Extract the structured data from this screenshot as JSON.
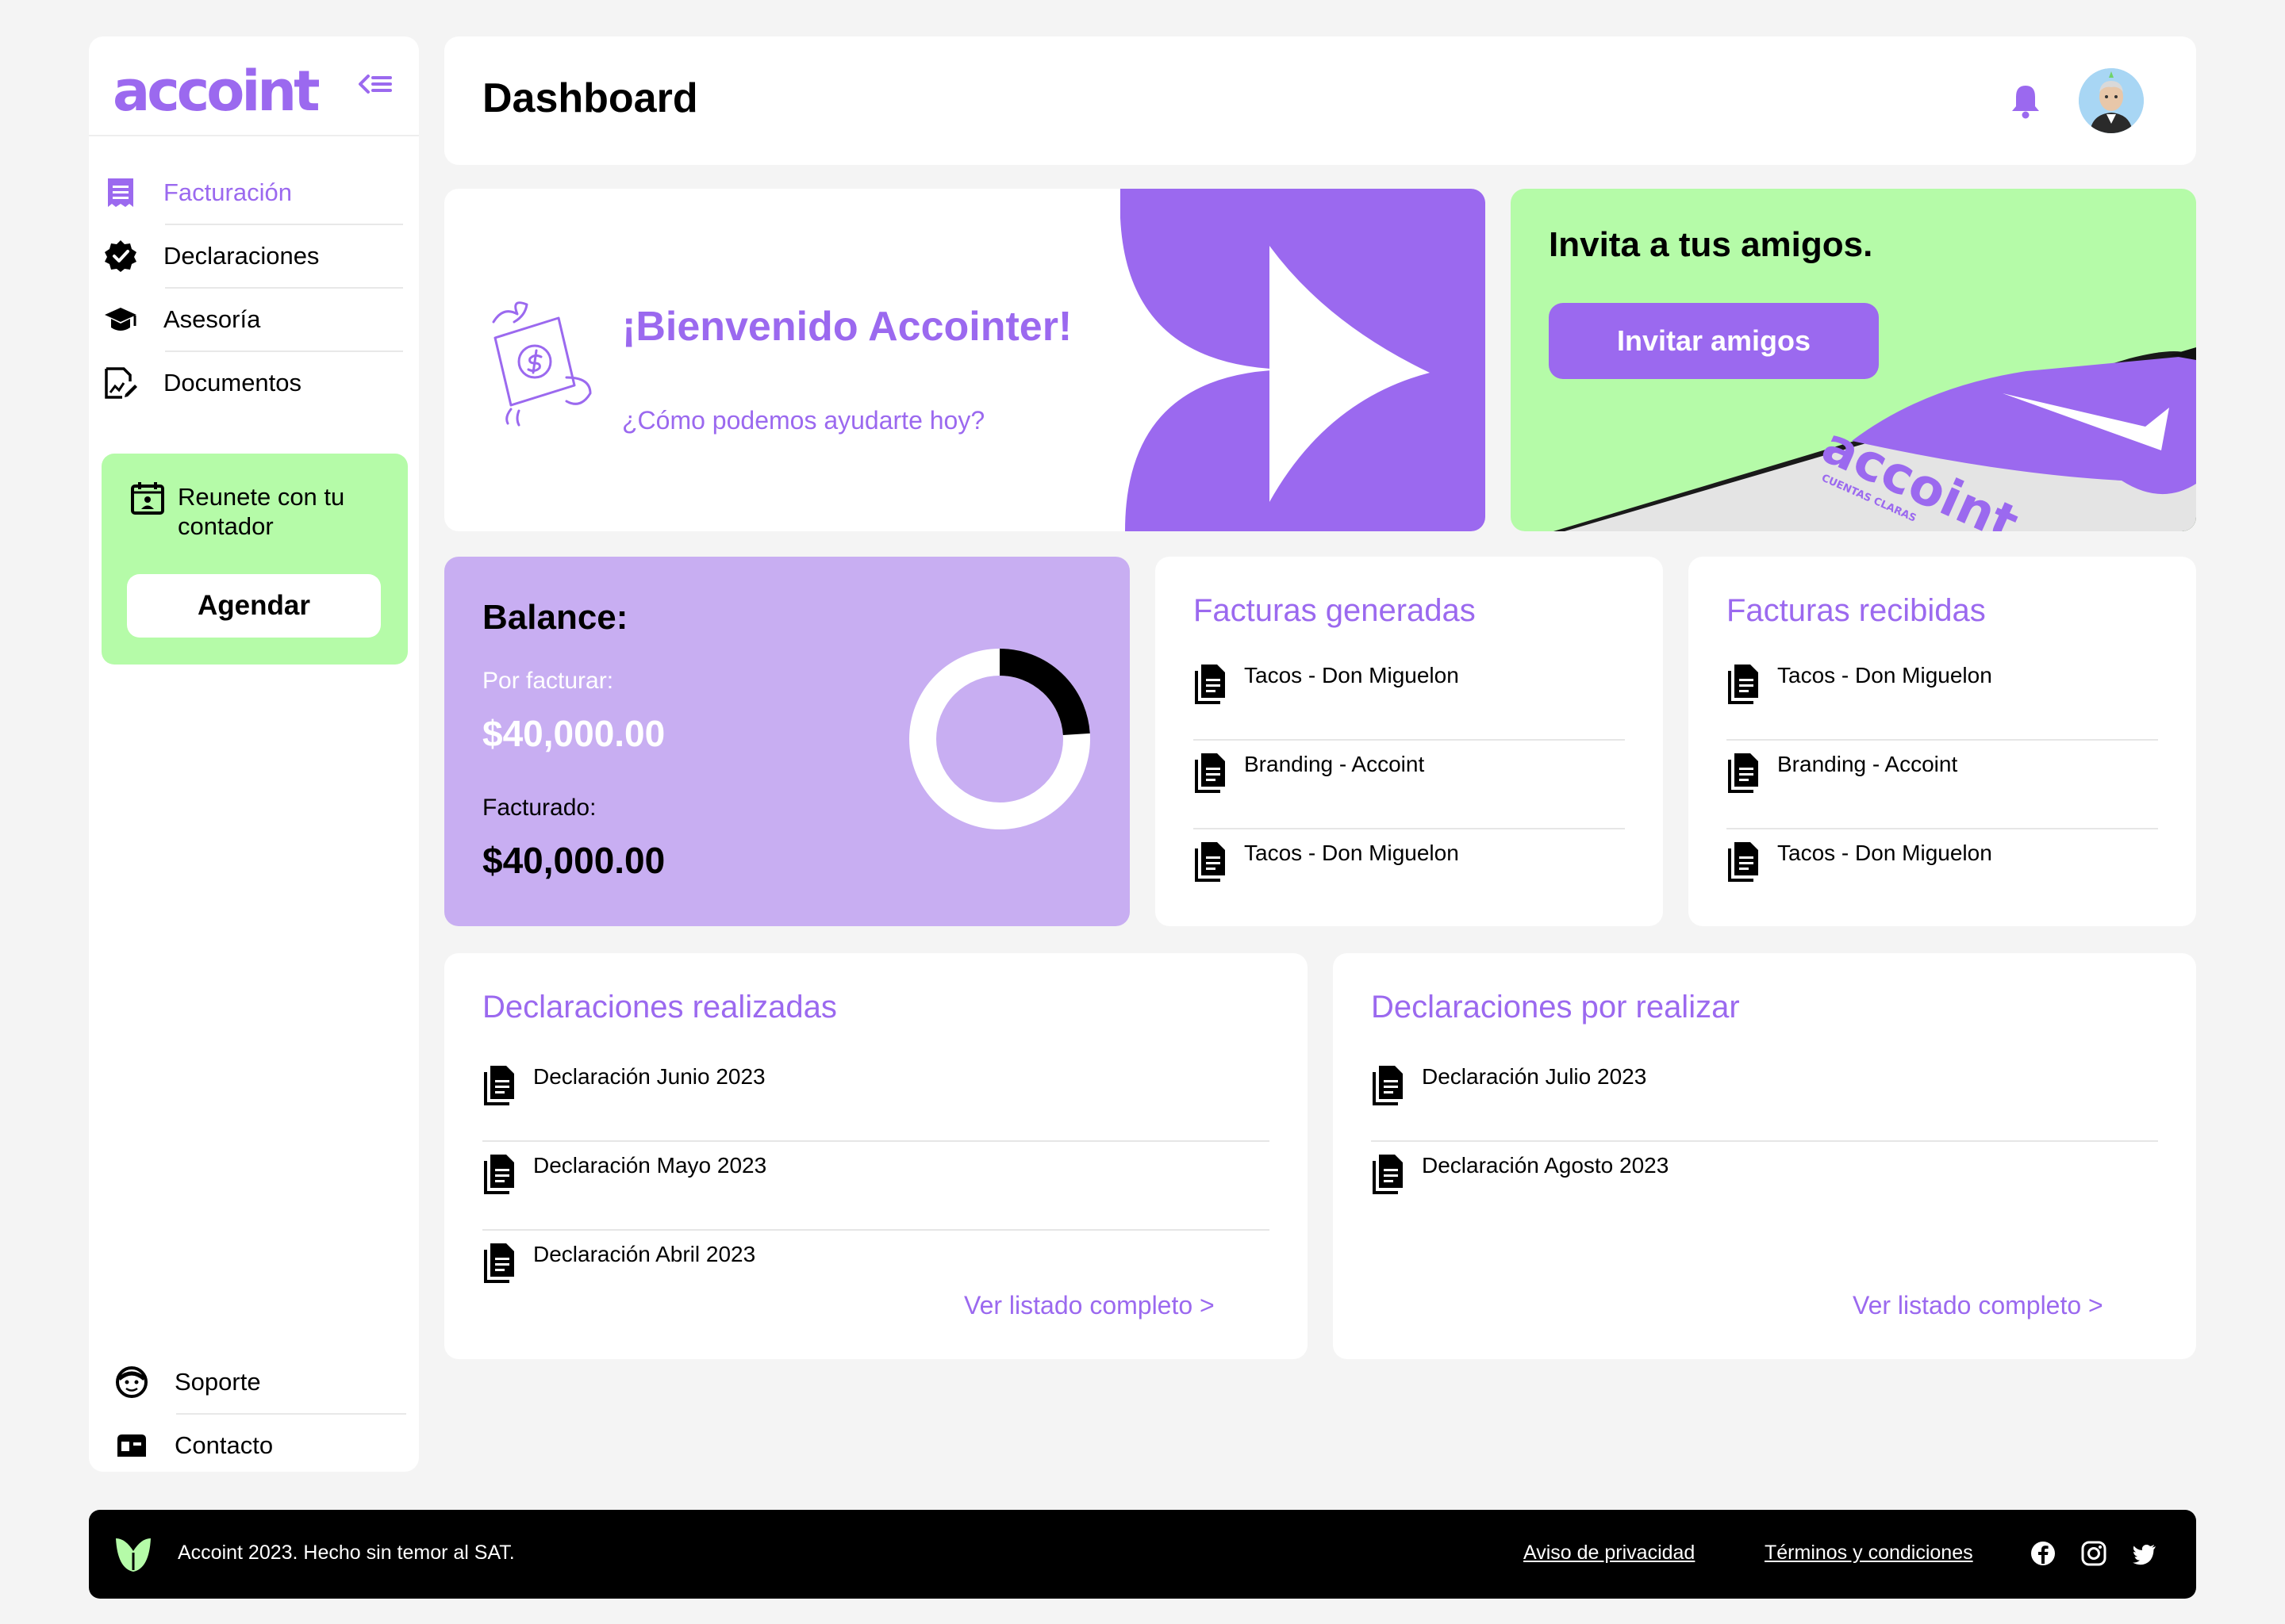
{
  "brand": {
    "logo_text": "accoint",
    "accent": "#9b69ef",
    "green": "#b5fba8",
    "lavender": "#c8aef2"
  },
  "sidebar": {
    "items": [
      {
        "label": "Facturación",
        "icon": "receipt-icon",
        "active": true
      },
      {
        "label": "Declaraciones",
        "icon": "verified-badge-icon",
        "active": false
      },
      {
        "label": "Asesoría",
        "icon": "graduation-cap-icon",
        "active": false
      },
      {
        "label": "Documentos",
        "icon": "document-chart-icon",
        "active": false
      }
    ],
    "meeting": {
      "text": "Reunete con tu contador",
      "icon": "calendar-person-icon",
      "button": "Agendar"
    },
    "bottom_items": [
      {
        "label": "Soporte",
        "icon": "support-agent-icon"
      },
      {
        "label": "Contacto",
        "icon": "mailbox-icon"
      }
    ]
  },
  "header": {
    "title": "Dashboard",
    "notification_icon": "bell-icon",
    "avatar": "user-avatar"
  },
  "welcome": {
    "title": "¡Bienvenido Accointer!",
    "subtitle": "¿Cómo podemos ayudarte hoy?"
  },
  "invite": {
    "title": "Invita a tus amigos.",
    "button": "Invitar amigos",
    "phone_logo": "accoint",
    "phone_tagline": "CUENTAS CLARAS"
  },
  "balance": {
    "title": "Balance:",
    "pending_label": "Por facturar:",
    "pending_value": "$40,000.00",
    "billed_label": "Facturado:",
    "billed_value": "$40,000.00",
    "donut_fraction_black": 0.24
  },
  "invoices_generated": {
    "title": "Facturas generadas",
    "items": [
      "Tacos - Don Miguelon",
      "Branding - Accoint",
      "Tacos - Don Miguelon"
    ]
  },
  "invoices_received": {
    "title": "Facturas recibidas",
    "items": [
      "Tacos - Don Miguelon",
      "Branding - Accoint",
      "Tacos - Don Miguelon"
    ]
  },
  "declarations_done": {
    "title": "Declaraciones realizadas",
    "items": [
      "Declaración Junio 2023",
      "Declaración Mayo 2023",
      "Declaración Abril 2023"
    ],
    "more": "Ver listado completo >"
  },
  "declarations_todo": {
    "title": "Declaraciones por realizar",
    "items": [
      "Declaración Julio 2023",
      "Declaración Agosto 2023"
    ],
    "more": "Ver listado completo >"
  },
  "footer": {
    "copyright": "Accoint 2023. Hecho sin temor al SAT.",
    "privacy": "Aviso de privacidad",
    "terms": "Términos y condiciones",
    "social": [
      "facebook-icon",
      "instagram-icon",
      "twitter-icon"
    ]
  }
}
